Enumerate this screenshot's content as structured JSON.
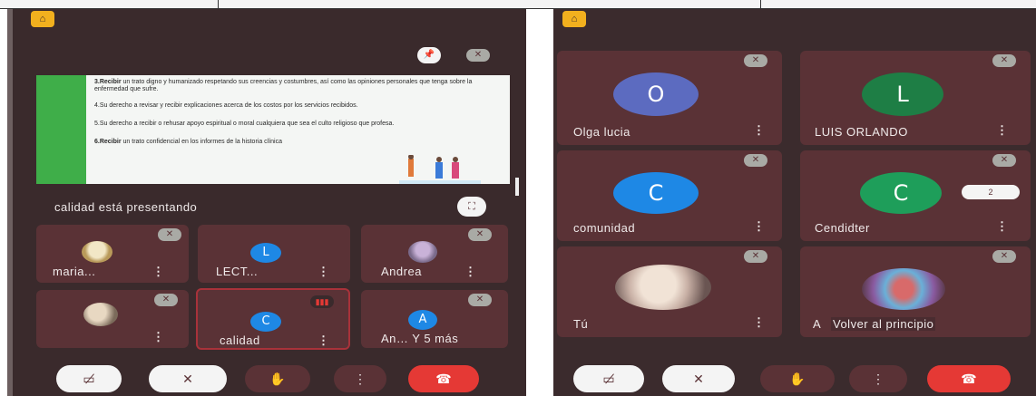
{
  "left_screen": {
    "logo_glyph": "⌂",
    "pin_icon": "pin-icon",
    "slide": {
      "lines": [
        {
          "lead": "3.Recibir",
          "text": " un trato digno y humanizado respetando sus creencias y costumbres, así como las opiniones personales que tenga sobre la enfermedad que sufre."
        },
        {
          "lead": "",
          "text": "4.Su derecho a revisar y recibir explicaciones acerca de los costos por los servicios recibidos."
        },
        {
          "lead": "",
          "text": "5.Su derecho a recibir o rehusar apoyo espiritual o moral cualquiera que sea el culto religioso que profesa."
        },
        {
          "lead": "6.Recibir",
          "text": " un trato confidencial en los informes de la historia clínica"
        }
      ]
    },
    "presenting_text": "calidad está presentando",
    "participants": [
      {
        "name": "maria...",
        "kind": "photo"
      },
      {
        "name": "LECT...",
        "kind": "initial",
        "initial": "L",
        "color": "#1e88e5"
      },
      {
        "name": "Andrea",
        "kind": "photo"
      },
      {
        "name": "",
        "kind": "photo"
      },
      {
        "name": "calidad",
        "kind": "initial",
        "initial": "C",
        "color": "#1e88e5"
      },
      {
        "name": "An… Y 5 más",
        "kind": "initial",
        "initial": "A",
        "color": "#1e88e5"
      }
    ]
  },
  "right_screen": {
    "logo_glyph": "⌂",
    "participants": [
      {
        "name": "Olga lucia",
        "initial": "O",
        "color": "#5c6bc0"
      },
      {
        "name": "LUIS ORLANDO",
        "initial": "L",
        "color": "#1e7e45"
      },
      {
        "name": "comunidad",
        "initial": "C",
        "color": "#1e88e5"
      },
      {
        "name": "Cendidter",
        "initial": "C",
        "color": "#1e9e5a"
      },
      {
        "name": "Tú",
        "kind": "photo"
      },
      {
        "name": "A",
        "kind": "photo"
      }
    ],
    "count_badge": "2",
    "back_to_top_label": "Volver al principio"
  },
  "controls": {
    "camera_off_icon": "camera-off-icon",
    "mic_off_icon": "mic-off-icon",
    "raise_hand_icon": "raise-hand-icon",
    "more_icon": "more-options-icon",
    "hang_up_icon": "hang-up-icon"
  },
  "colors": {
    "background": "#3a2a2c",
    "tile": "#5a3236",
    "accent_red": "#e53935",
    "logo_yellow": "#f2b01e",
    "slide_green": "#3fae49"
  }
}
